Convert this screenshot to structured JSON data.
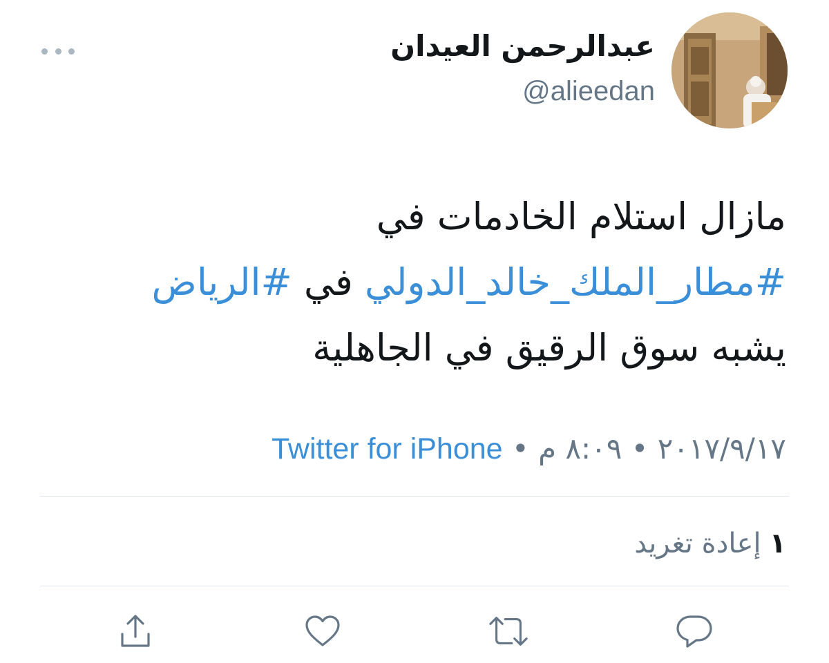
{
  "user": {
    "display_name": "عبدالرحمن العيدان",
    "handle": "@alieedan"
  },
  "tweet": {
    "text_line1": "مازال استلام الخادمات في",
    "hashtag_airport": "#مطار_الملك_خالد_الدولي",
    "text_in": "في",
    "hashtag_city": "#الرياض",
    "text_line3": "يشبه سوق الرقيق في الجاهلية"
  },
  "meta": {
    "date": "٢٠١٧/٩/١٧",
    "separator": "•",
    "time": "٨:٠٩ م",
    "source": "Twitter for iPhone"
  },
  "stats": {
    "retweet_count": "١",
    "retweet_label": "إعادة تغريد"
  },
  "actions": [
    {
      "icon": "reply-icon"
    },
    {
      "icon": "retweet-icon"
    },
    {
      "icon": "heart-icon"
    },
    {
      "icon": "share-icon"
    }
  ],
  "colors": {
    "link": "#3a8fd8",
    "secondary_text": "#657786",
    "icon": "#657786",
    "divider": "#dde3e8"
  }
}
